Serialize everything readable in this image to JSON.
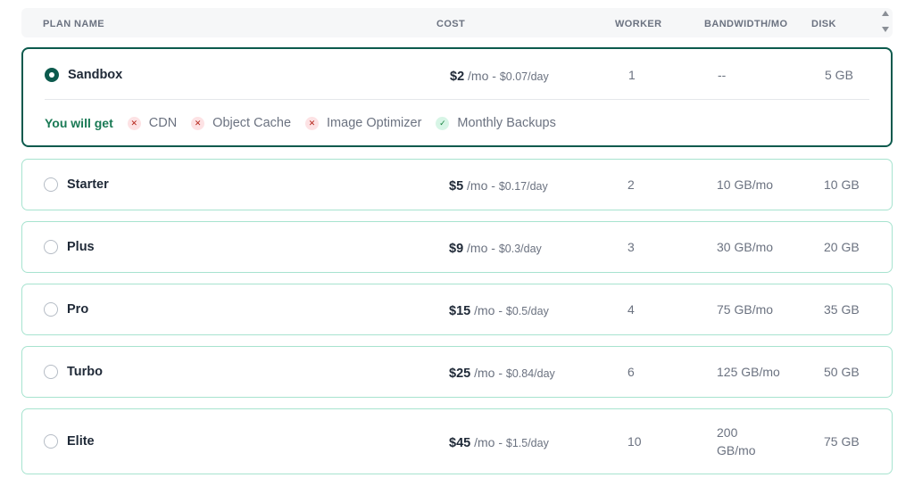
{
  "header": {
    "plan_name": "PLAN NAME",
    "cost": "COST",
    "worker": "WORKER",
    "bandwidth": "BANDWIDTH/MO",
    "disk": "DISK"
  },
  "features_label": "You will get",
  "colors": {
    "accent": "#0c5a4d",
    "row_border": "#a7e3cf",
    "feature_label": "#1a7a55",
    "feature_no": "#b42318",
    "feature_yes": "#15803d"
  },
  "plans": [
    {
      "name": "Sandbox",
      "selected": true,
      "price": "$2",
      "per": "/mo -",
      "day": "$0.07/day",
      "worker": "1",
      "bandwidth": "--",
      "disk": "5 GB",
      "features": [
        {
          "label": "CDN",
          "included": false,
          "icon": "x-icon"
        },
        {
          "label": "Object Cache",
          "included": false,
          "icon": "x-icon"
        },
        {
          "label": "Image Optimizer",
          "included": false,
          "icon": "x-icon"
        },
        {
          "label": "Monthly Backups",
          "included": true,
          "icon": "check-icon"
        }
      ]
    },
    {
      "name": "Starter",
      "selected": false,
      "price": "$5",
      "per": "/mo -",
      "day": "$0.17/day",
      "worker": "2",
      "bandwidth": "10 GB/mo",
      "disk": "10 GB"
    },
    {
      "name": "Plus",
      "selected": false,
      "price": "$9",
      "per": "/mo -",
      "day": "$0.3/day",
      "worker": "3",
      "bandwidth": "30 GB/mo",
      "disk": "20 GB"
    },
    {
      "name": "Pro",
      "selected": false,
      "price": "$15",
      "per": "/mo -",
      "day": "$0.5/day",
      "worker": "4",
      "bandwidth": "75 GB/mo",
      "disk": "35 GB"
    },
    {
      "name": "Turbo",
      "selected": false,
      "price": "$25",
      "per": "/mo -",
      "day": "$0.84/day",
      "worker": "6",
      "bandwidth": "125 GB/mo",
      "disk": "50 GB"
    },
    {
      "name": "Elite",
      "selected": false,
      "price": "$45",
      "per": "/mo -",
      "day": "$1.5/day",
      "worker": "10",
      "bandwidth": "200 GB/mo",
      "disk": "75 GB"
    }
  ]
}
